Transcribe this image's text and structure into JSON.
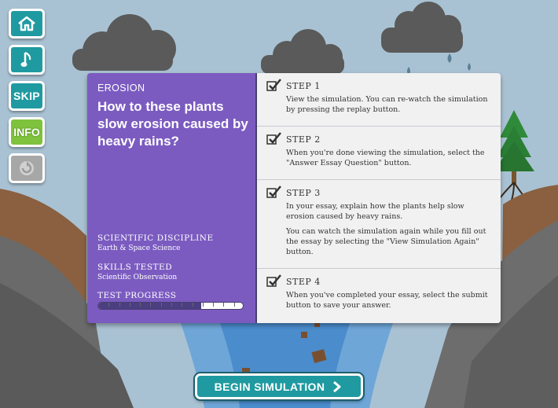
{
  "sidebar": {
    "home_icon": "home-icon",
    "music_icon": "music-note-icon",
    "skip_label": "SKIP",
    "info_label": "INFO",
    "replay_icon": "replay-icon"
  },
  "panel": {
    "subject": "EROSION",
    "question": "How to these plants slow erosion caused by heavy rains?",
    "discipline_label": "SCIENTIFIC DISCIPLINE",
    "discipline_value": "Earth & Space Science",
    "skills_label": "SKILLS TESTED",
    "skills_value": "Scientific Observation",
    "progress_label": "TEST PROGRESS",
    "progress_fraction": 0.71
  },
  "steps": [
    {
      "title": "STEP 1",
      "text": "View the simulation. You can re-watch the simulation by pressing the replay button."
    },
    {
      "title": "STEP 2",
      "text": "When you're done viewing the simulation, select the \"Answer Essay Question\" button."
    },
    {
      "title": "STEP 3",
      "text": "In your essay, explain how the plants help slow erosion caused by heavy rains.",
      "text2": "You can watch the simulation again while you fill out the essay by selecting the \"View Simulation Again\" button."
    },
    {
      "title": "STEP 4",
      "text": "When you've completed your essay, select the submit button to save your answer."
    }
  ],
  "begin_button": {
    "label": "BEGIN SIMULATION"
  },
  "colors": {
    "accent_teal": "#1f9aa0",
    "panel_purple": "#7b5bc0",
    "info_green": "#7ec23d"
  }
}
